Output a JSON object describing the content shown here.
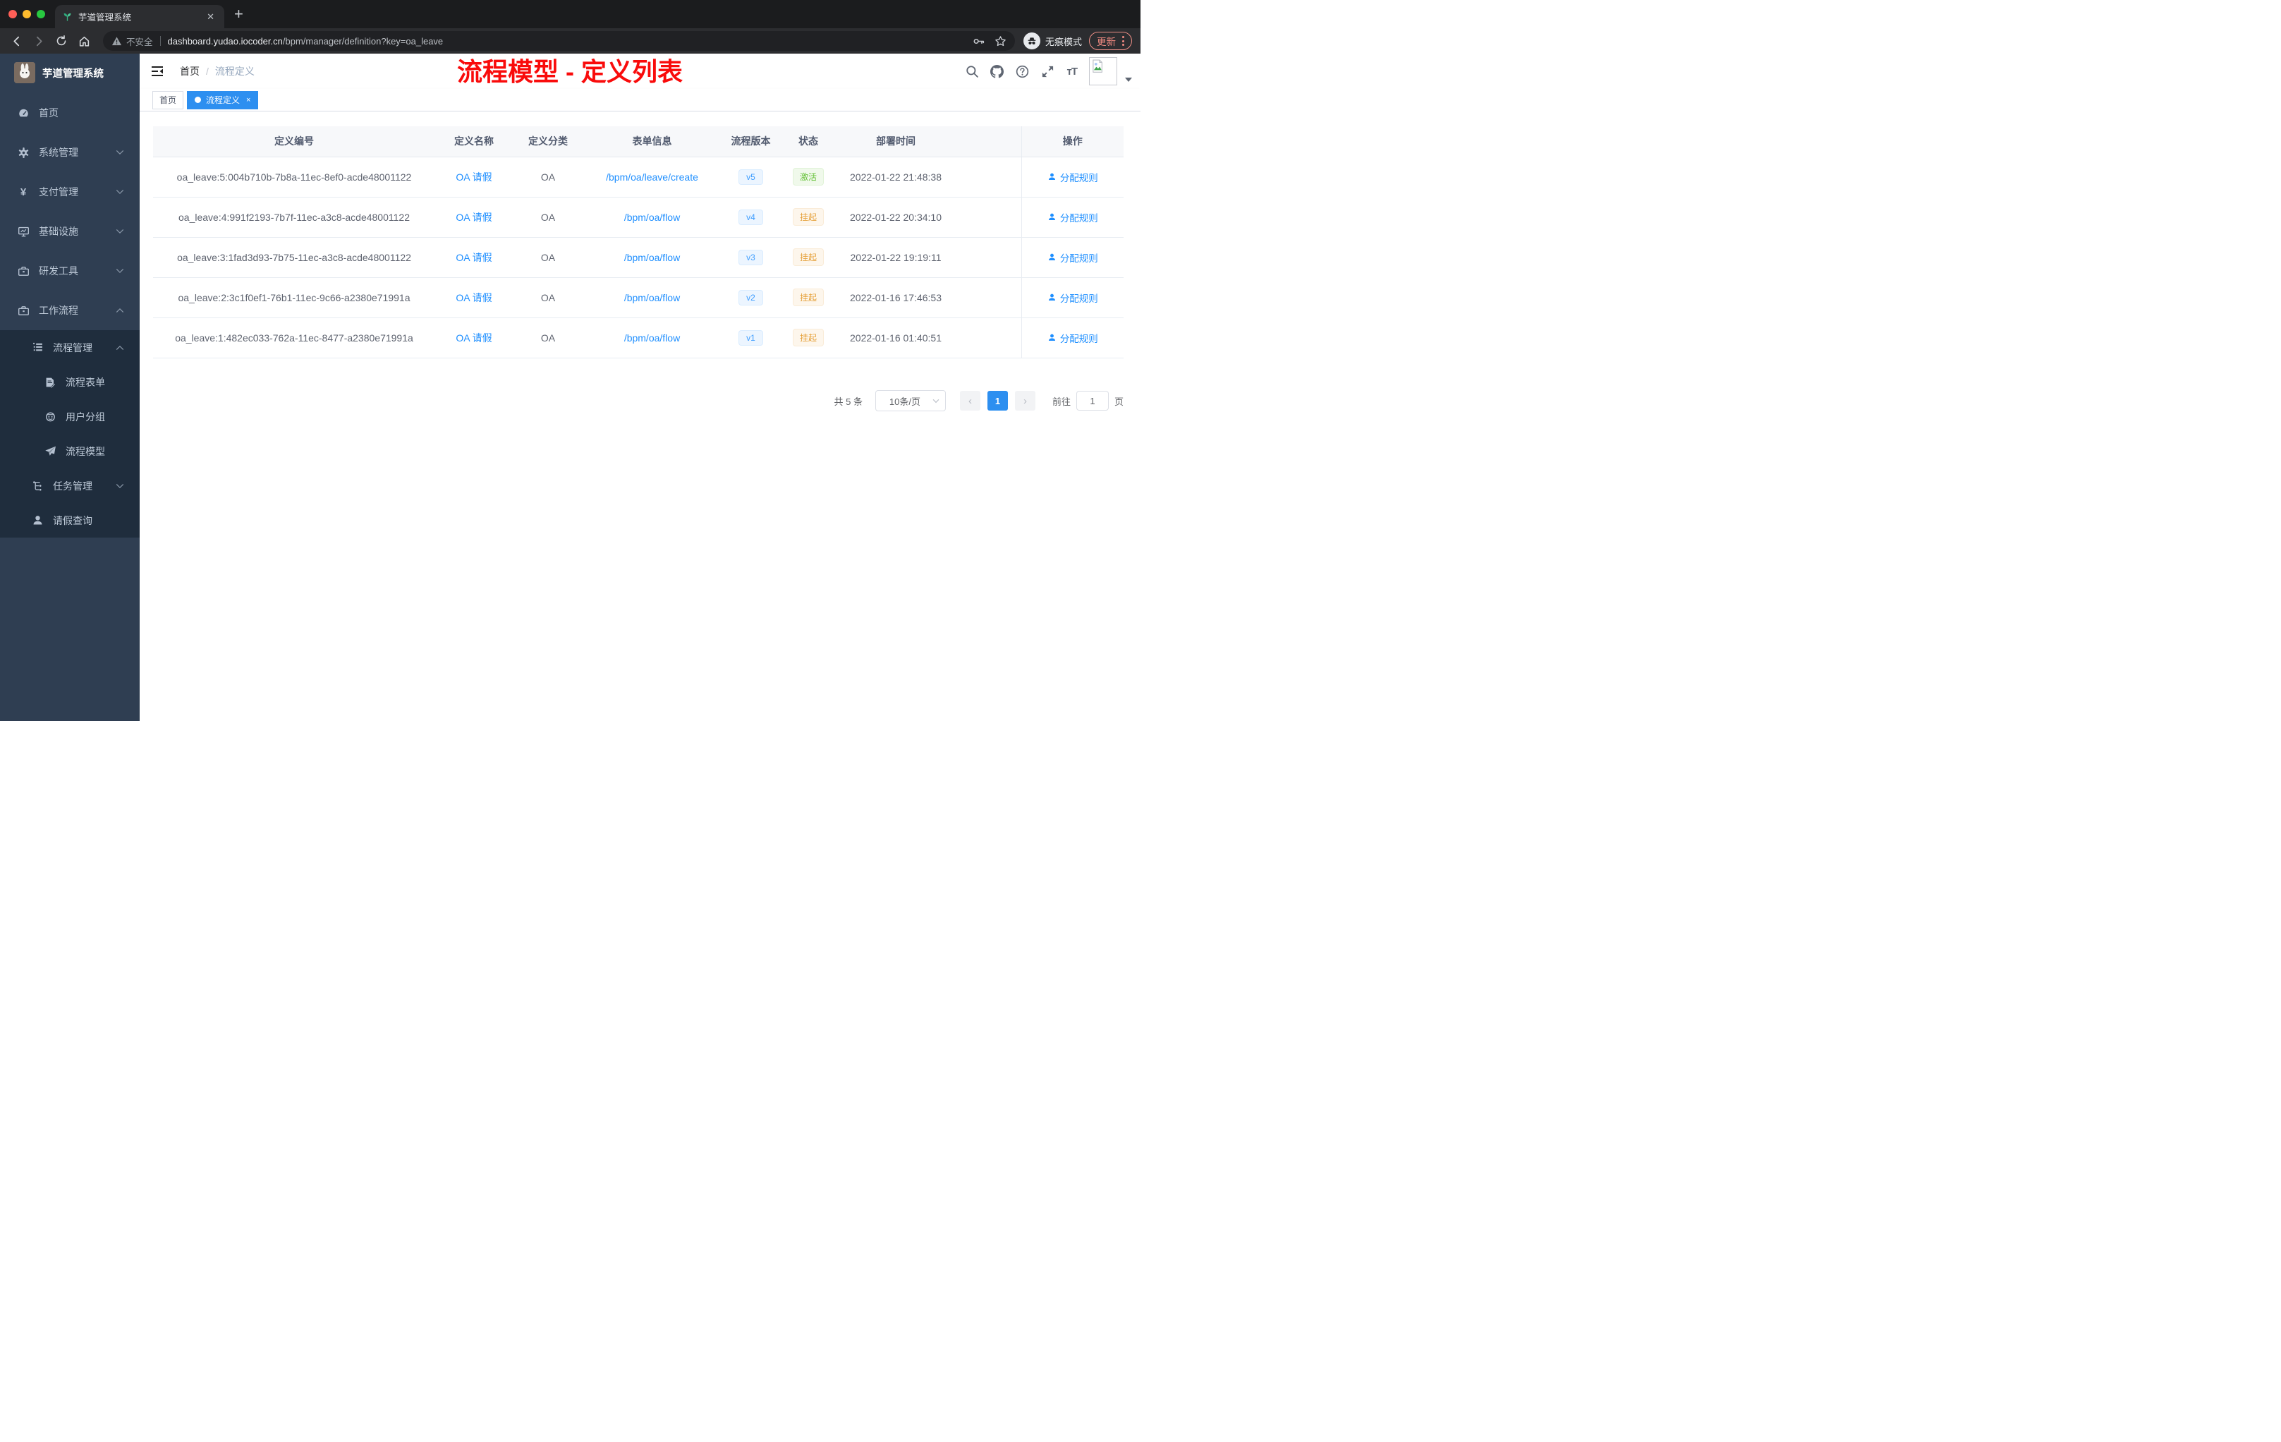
{
  "browser": {
    "tab_title": "芋道管理系统",
    "new_tab": "+",
    "security_label": "不安全",
    "url_host": "dashboard.yudao.iocoder.cn",
    "url_path": "/bpm/manager/definition?key=oa_leave",
    "incognito_label": "无痕模式",
    "update_label": "更新"
  },
  "sidebar": {
    "logo_title": "芋道管理系统",
    "menu": [
      {
        "label": "首页",
        "icon": "dashboard-icon"
      },
      {
        "label": "系统管理",
        "icon": "gear-icon",
        "arrow": "down"
      },
      {
        "label": "支付管理",
        "icon": "yen-icon",
        "arrow": "down"
      },
      {
        "label": "基础设施",
        "icon": "monitor-icon",
        "arrow": "down"
      },
      {
        "label": "研发工具",
        "icon": "toolbox-icon",
        "arrow": "down"
      },
      {
        "label": "工作流程",
        "icon": "briefcase-icon",
        "arrow": "up"
      },
      {
        "label": "流程管理",
        "icon": "list-tree-icon",
        "arrow": "up"
      },
      {
        "label": "流程表单",
        "icon": "form-edit-icon"
      },
      {
        "label": "用户分组",
        "icon": "user-group-icon"
      },
      {
        "label": "流程模型",
        "icon": "paper-plane-icon"
      },
      {
        "label": "任务管理",
        "icon": "tree-icon",
        "arrow": "down"
      },
      {
        "label": "请假查询",
        "icon": "person-icon"
      }
    ]
  },
  "navbar": {
    "breadcrumb_home": "首页",
    "breadcrumb_sep": "/",
    "breadcrumb_current": "流程定义"
  },
  "tags": {
    "home": "首页",
    "active": "流程定义",
    "close": "×"
  },
  "annotation": "流程模型 - 定义列表",
  "table": {
    "columns": [
      "定义编号",
      "定义名称",
      "定义分类",
      "表单信息",
      "流程版本",
      "状态",
      "部署时间",
      "操作"
    ],
    "action_label": "分配规则",
    "rows": [
      {
        "id": "oa_leave:5:004b710b-7b8a-11ec-8ef0-acde48001122",
        "name": "OA 请假",
        "category": "OA",
        "form": "/bpm/oa/leave/create",
        "version": "v5",
        "status": "激活",
        "status_type": "success",
        "deployed_at": "2022-01-22 21:48:38"
      },
      {
        "id": "oa_leave:4:991f2193-7b7f-11ec-a3c8-acde48001122",
        "name": "OA 请假",
        "category": "OA",
        "form": "/bpm/oa/flow",
        "version": "v4",
        "status": "挂起",
        "status_type": "warning",
        "deployed_at": "2022-01-22 20:34:10"
      },
      {
        "id": "oa_leave:3:1fad3d93-7b75-11ec-a3c8-acde48001122",
        "name": "OA 请假",
        "category": "OA",
        "form": "/bpm/oa/flow",
        "version": "v3",
        "status": "挂起",
        "status_type": "warning",
        "deployed_at": "2022-01-22 19:19:11"
      },
      {
        "id": "oa_leave:2:3c1f0ef1-76b1-11ec-9c66-a2380e71991a",
        "name": "OA 请假",
        "category": "OA",
        "form": "/bpm/oa/flow",
        "version": "v2",
        "status": "挂起",
        "status_type": "warning",
        "deployed_at": "2022-01-16 17:46:53"
      },
      {
        "id": "oa_leave:1:482ec033-762a-11ec-8477-a2380e71991a",
        "name": "OA 请假",
        "category": "OA",
        "form": "/bpm/oa/flow",
        "version": "v1",
        "status": "挂起",
        "status_type": "warning",
        "deployed_at": "2022-01-16 01:40:51"
      }
    ]
  },
  "pagination": {
    "total": "共 5 条",
    "page_size": "10条/页",
    "prev": "‹",
    "current": "1",
    "next": "›",
    "goto_label": "前往",
    "goto_value": "1",
    "unit_label": "页"
  },
  "icons": {
    "favicon": "seedling-icon",
    "security": "warning-triangle-icon",
    "navbar_right": [
      "search-icon",
      "github-icon",
      "help-icon",
      "fullscreen-icon",
      "font-size-icon",
      "avatar-broken-image-icon"
    ]
  },
  "colors": {
    "accent": "#2d8ff0",
    "link": "#1f8fff",
    "sidebar_bg": "#2f3e52",
    "submenu_bg": "#1f2d3d",
    "success": "#67c23a",
    "warning": "#e6a23c",
    "annotation_red": "#f90b0b",
    "chrome_update": "#f28b82"
  }
}
